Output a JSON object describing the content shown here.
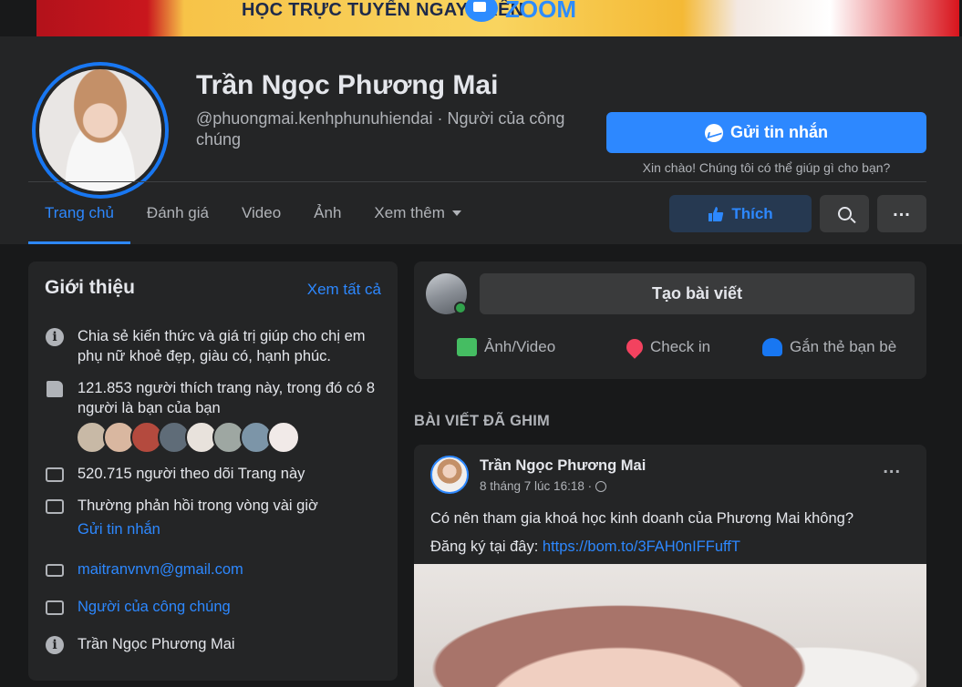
{
  "cover": {
    "text": "HỌC TRỰC TUYẾN NGAY TRÊN",
    "zoom": "ZOOM"
  },
  "profile": {
    "name": "Trần Ngọc Phương Mai",
    "handle": "@phuongmai.kenhphunuhiendai · Người của công chúng",
    "message_button": "Gửi tin nhắn",
    "greeting": "Xin chào! Chúng tôi có thể giúp gì cho bạn?"
  },
  "tabs": [
    {
      "label": "Trang chủ"
    },
    {
      "label": "Đánh giá"
    },
    {
      "label": "Video"
    },
    {
      "label": "Ảnh"
    },
    {
      "label": "Xem thêm"
    }
  ],
  "actions": {
    "like": "Thích"
  },
  "intro": {
    "title": "Giới thiệu",
    "see_all": "Xem tất cả",
    "about": "Chia sẻ kiến thức và giá trị giúp cho chị em phụ nữ khoẻ đẹp, giàu có, hạnh phúc.",
    "likes": "121.853 người thích trang này, trong đó có 8 người là bạn của bạn",
    "followers": "520.715 người theo dõi Trang này",
    "response": "Thường phản hồi trong vòng vài giờ",
    "send_message": "Gửi tin nhắn",
    "email": "maitranvnvn@gmail.com",
    "category": "Người của công chúng",
    "name": "Trần Ngọc Phương Mai"
  },
  "create_post": {
    "button": "Tạo bài viết",
    "photo_video": "Ảnh/Video",
    "check_in": "Check in",
    "tag_friends": "Gắn thẻ bạn bè"
  },
  "pinned": {
    "label": "BÀI VIẾT ĐÃ GHIM",
    "author": "Trần Ngọc Phương Mai",
    "time": "8 tháng 7 lúc 16:18 ·",
    "text": "Có nên tham gia khoá học kinh doanh của Phương Mai không?",
    "register_prefix": "Đăng ký tại đây: ",
    "link": "https://bom.to/3FAH0nIFFuffT"
  },
  "colors": {
    "accent": "#2d88ff",
    "background": "#18191a",
    "card": "#242526"
  }
}
